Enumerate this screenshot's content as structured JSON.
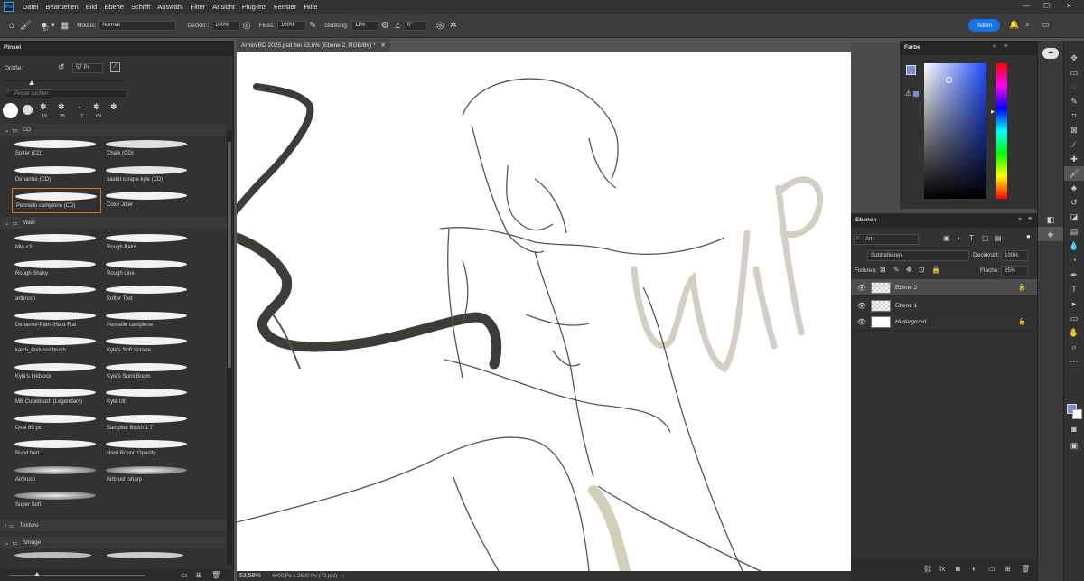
{
  "menubar": {
    "items": [
      "Datei",
      "Bearbeiten",
      "Bild",
      "Ebene",
      "Schrift",
      "Auswahl",
      "Filter",
      "Ansicht",
      "Plug-ins",
      "Fenster",
      "Hilfe"
    ]
  },
  "options": {
    "brush_size": "57",
    "mode_label": "Modus:",
    "mode_value": "Normal",
    "opacity_label": "Deckkr.:",
    "opacity_value": "100%",
    "flow_label": "Fluss:",
    "flow_value": "100%",
    "smoothing_label": "Glättung:",
    "smoothing_value": "11%",
    "angle_value": "0°",
    "share_label": "Teilen"
  },
  "brush_panel": {
    "tab": "Pinsel",
    "size_label": "Größe:",
    "size_value": "57 Px",
    "search_placeholder": "Pinsel suchen",
    "preset_sizes": [
      "19",
      "25",
      "7",
      "89"
    ],
    "folders": [
      {
        "name": "CD",
        "brushes": [
          "Softer (CD)",
          "Chalk (CD)",
          "Deharme (CD)",
          "pastel scrape kyle (CD)",
          "Pennello campione (CD)",
          "Color Jitter"
        ]
      },
      {
        "name": "Main",
        "brushes": [
          "Min <3",
          "Rough Paint",
          "Rough Shaky",
          "Rough Line",
          "artbrush",
          "Softer Text",
          "Deharme-Paint-Hard-Flat",
          "Pennello campione",
          "kaish_textured brush",
          "Kyle's Soft Scrape",
          "Kyle's Inkblock",
          "Kyle's Sumi Boom",
          "MB Cubebrush (Legendary)",
          "Kyle Ult",
          "Oval 60 px",
          "Sampled Brush 1 7",
          "Rund hart",
          "Hard Round Opacity",
          "Airbrush",
          "Airbrush sharp",
          "Super Soft"
        ]
      },
      {
        "name": "Texture",
        "brushes": []
      },
      {
        "name": "Smuge",
        "brushes": []
      }
    ]
  },
  "document": {
    "tab_title": "Armin BD 2025.psd bei 53,6% (Ebene 2, RGB/8#) *",
    "zoom": "53,59%",
    "doc_info": "4000 Px x 2500 Px (72 ppi)"
  },
  "color_panel": {
    "title": "Farbe"
  },
  "layers_panel": {
    "title": "Ebenen",
    "filter_value": "Art",
    "blend_mode": "Subtrahieren",
    "opacity_label": "Deckkraft:",
    "opacity_value": "100%",
    "lock_label": "Fixieren:",
    "fill_label": "Fläche:",
    "fill_value": "25%",
    "layers": [
      "Ebene 2",
      "Ebene 1",
      "Hintergrund"
    ]
  },
  "colors": {
    "accent": "#1473e6",
    "selection_orange": "#e27220",
    "wip_color": "#d4cfc3"
  }
}
